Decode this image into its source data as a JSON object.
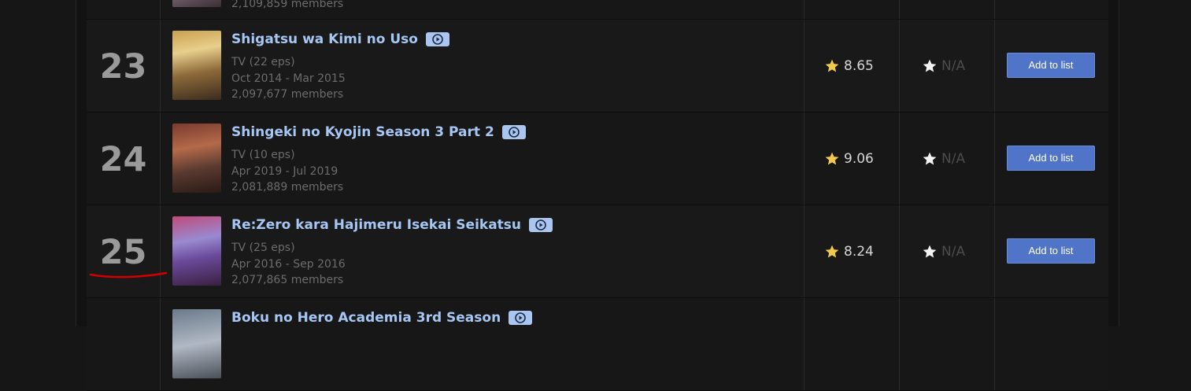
{
  "rows": [
    {
      "rank": "",
      "title": "",
      "type": "",
      "dates": "",
      "members": "2,109,859 members",
      "score": "",
      "your_score": ""
    },
    {
      "rank": "23",
      "title": "Shigatsu wa Kimi no Uso",
      "type": "TV (22 eps)",
      "dates": "Oct 2014 - Mar 2015",
      "members": "2,097,677 members",
      "score": "8.65",
      "your_score": "N/A",
      "button": "Add to list"
    },
    {
      "rank": "24",
      "title": "Shingeki no Kyojin Season 3 Part 2",
      "type": "TV (10 eps)",
      "dates": "Apr 2019 - Jul 2019",
      "members": "2,081,889 members",
      "score": "9.06",
      "your_score": "N/A",
      "button": "Add to list"
    },
    {
      "rank": "25",
      "title": "Re:Zero kara Hajimeru Isekai Seikatsu",
      "type": "TV (25 eps)",
      "dates": "Apr 2016 - Sep 2016",
      "members": "2,077,865 members",
      "score": "8.24",
      "your_score": "N/A",
      "button": "Add to list"
    },
    {
      "rank": "",
      "title": "Boku no Hero Academia 3rd Season",
      "type": "",
      "dates": "",
      "members": "",
      "score": "",
      "your_score": ""
    }
  ],
  "icons": {
    "play": "play-circle-icon",
    "score_star": "gold-star-icon",
    "your_score_star": "white-star-icon"
  },
  "colors": {
    "title_link": "#a6c6f3",
    "button": "#4f74c8",
    "annotation": "#d40000"
  }
}
